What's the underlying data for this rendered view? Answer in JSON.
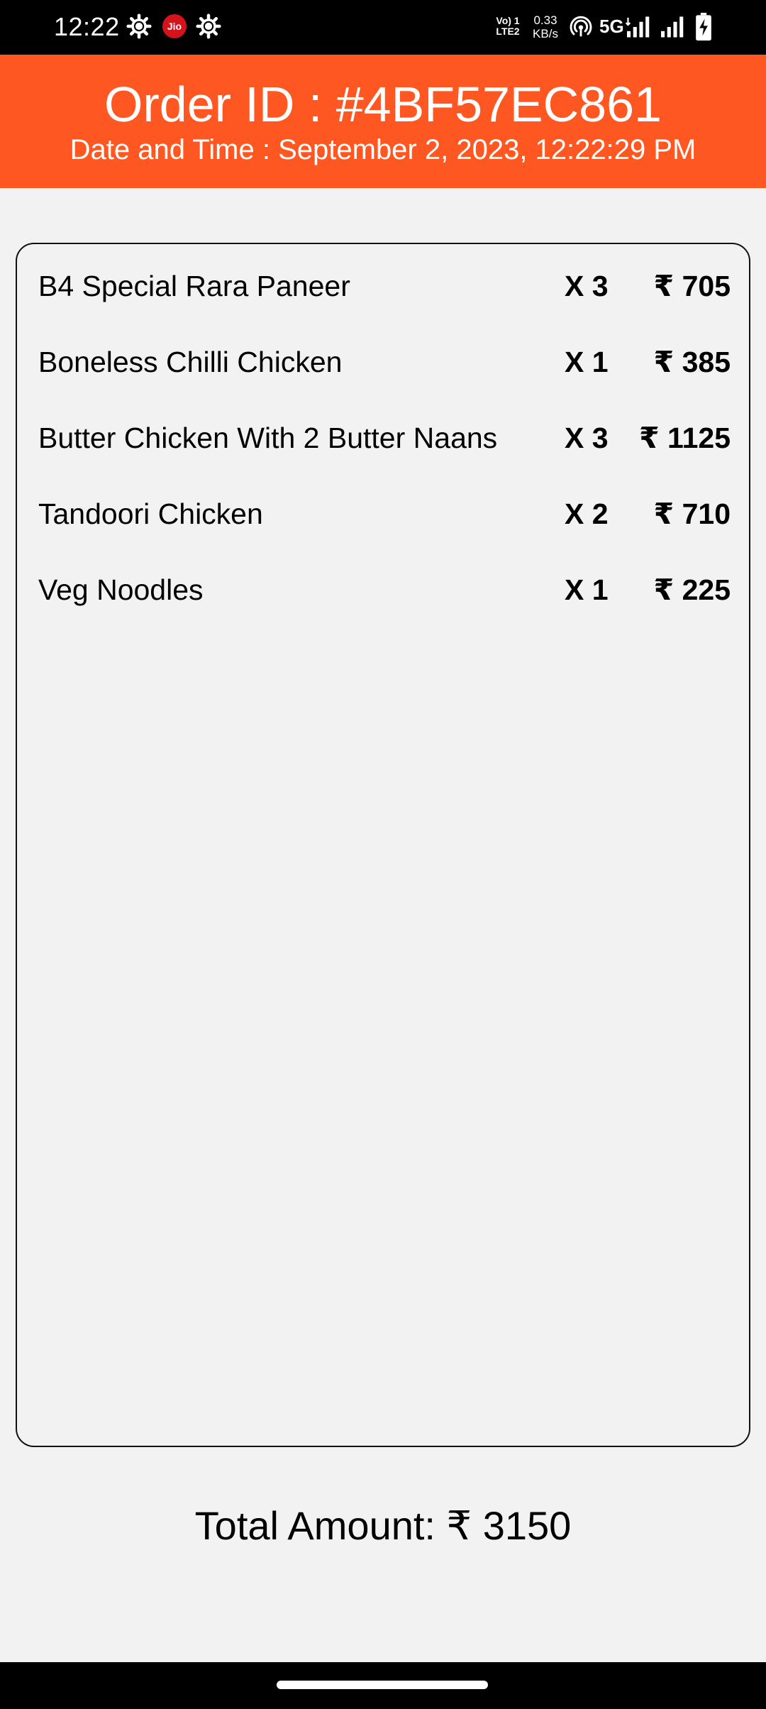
{
  "status_bar": {
    "time": "12:22",
    "jio_label": "Jio",
    "volte_line1": "Vo) 1",
    "volte_line2": "LTE2",
    "speed_value": "0.33",
    "speed_unit": "KB/s",
    "network": "5G",
    "icons": [
      "gear-icon",
      "jio-icon",
      "gear-icon",
      "volte-icon",
      "hotspot-icon",
      "signal-icon",
      "signal-icon",
      "battery-charging-icon"
    ]
  },
  "header": {
    "order_id": "Order ID : #4BF57EC861",
    "date_time": "Date and Time : September 2, 2023, 12:22:29 PM",
    "background_color": "#ff5722"
  },
  "items": [
    {
      "name": "B4 Special Rara Paneer",
      "qty": "X 3",
      "price": "₹ 705"
    },
    {
      "name": "Boneless Chilli Chicken",
      "qty": "X 1",
      "price": "₹ 385"
    },
    {
      "name": "Butter Chicken With 2 Butter Naans",
      "qty": "X 3",
      "price": "₹ 1125"
    },
    {
      "name": "Tandoori Chicken",
      "qty": "X 2",
      "price": "₹ 710"
    },
    {
      "name": "Veg Noodles",
      "qty": "X 1",
      "price": "₹ 225"
    }
  ],
  "total": {
    "label": "Total Amount: ₹ 3150"
  }
}
